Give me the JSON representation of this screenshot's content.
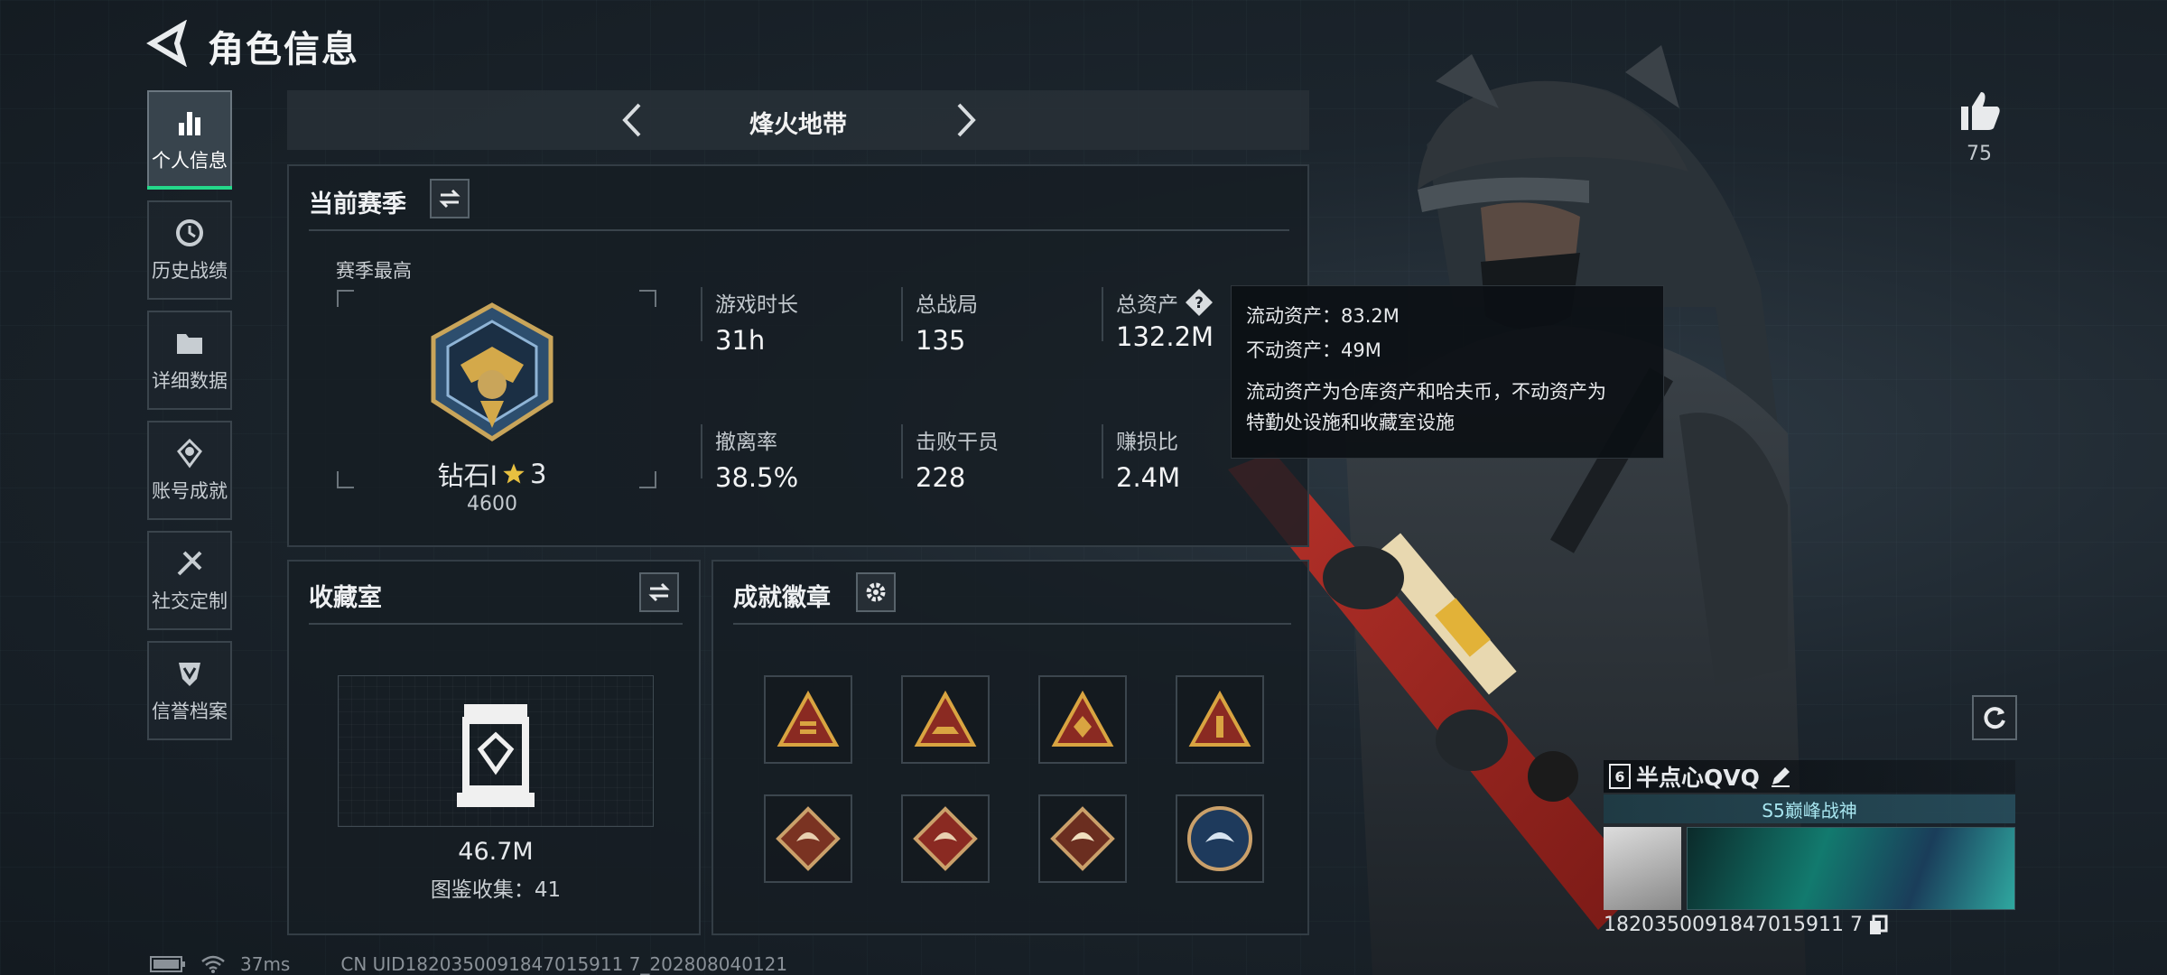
{
  "header": {
    "title": "角色信息"
  },
  "sidebar": {
    "items": [
      {
        "label": "个人信息",
        "active": true,
        "icon": "bar-chart-icon"
      },
      {
        "label": "历史战绩",
        "icon": "clock-icon"
      },
      {
        "label": "详细数据",
        "icon": "folder-icon"
      },
      {
        "label": "账号成就",
        "icon": "achievement-icon"
      },
      {
        "label": "社交定制",
        "icon": "tools-icon"
      },
      {
        "label": "信誉档案",
        "icon": "shield-icon"
      }
    ]
  },
  "mode": {
    "title": "烽火地带"
  },
  "season": {
    "title": "当前赛季",
    "best_label": "赛季最高",
    "rank_name": "钻石I",
    "rank_stars": "3",
    "rank_score": "4600",
    "stats": [
      {
        "label": "游戏时长",
        "value": "31h"
      },
      {
        "label": "总战局",
        "value": "135"
      },
      {
        "label": "总资产",
        "value": "132.2M"
      },
      {
        "label": "撤离率",
        "value": "38.5%"
      },
      {
        "label": "击败干员",
        "value": "228"
      },
      {
        "label": "赚损比",
        "value": "2.4M"
      }
    ]
  },
  "tooltip": {
    "liquid": "流动资产：83.2M",
    "fixed": "不动资产：49M",
    "desc_line1": "流动资产为仓库资产和哈夫币，不动资产为",
    "desc_line2": "特勤处设施和收藏室设施"
  },
  "collection": {
    "title": "收藏室",
    "value": "46.7M",
    "count": "图鉴收集：41"
  },
  "achievements": {
    "title": "成就徽章",
    "badges": [
      {
        "icon": "triangle-bars-badge-icon"
      },
      {
        "icon": "triangle-ship-badge-icon"
      },
      {
        "icon": "triangle-emblem-badge-icon"
      },
      {
        "icon": "triangle-number-badge-icon"
      },
      {
        "icon": "dragon-diamond-badge-icon"
      },
      {
        "icon": "dragon-diamond-red-badge-icon"
      },
      {
        "icon": "dragon-diamond-gold-badge-icon"
      },
      {
        "icon": "dragon-circle-badge-icon"
      }
    ]
  },
  "likes": {
    "count": "75"
  },
  "player": {
    "level": "6",
    "name": "半点心QVQ",
    "title": "S5巅峰战神",
    "uid": "1820350091847015911 7"
  },
  "status": {
    "ping": "37ms",
    "uid_line": "CN UID1820350091847015911 7_202808040121"
  },
  "colors": {
    "accent_green": "#24d88a",
    "rank_star": "#e8c040",
    "badge_gold": "#d9a441",
    "badge_red": "#8a2a22"
  }
}
